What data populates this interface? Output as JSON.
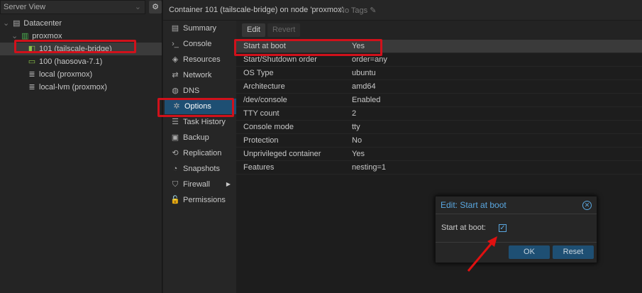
{
  "tree": {
    "view": "Server View",
    "items": [
      {
        "label": "Datacenter",
        "icon": "server-rack-icon"
      },
      {
        "label": "proxmox",
        "icon": "node-icon"
      },
      {
        "label": "101 (tailscale-bridge)",
        "icon": "container-icon"
      },
      {
        "label": "100 (haosova-7.1)",
        "icon": "vm-icon"
      },
      {
        "label": "local (proxmox)",
        "icon": "storage-icon"
      },
      {
        "label": "local-lvm (proxmox)",
        "icon": "storage-icon"
      }
    ]
  },
  "header": {
    "title": "Container 101 (tailscale-bridge) on node 'proxmox'",
    "tags": "No Tags"
  },
  "nav": [
    "Summary",
    "Console",
    "Resources",
    "Network",
    "DNS",
    "Options",
    "Task History",
    "Backup",
    "Replication",
    "Snapshots",
    "Firewall",
    "Permissions"
  ],
  "nav_icons": [
    "▤",
    "›_",
    "◈",
    "⇄",
    "◍",
    "✲",
    "☰",
    "▣",
    "⟲",
    "◔",
    "⛉",
    "🔓"
  ],
  "toolbar": {
    "edit": "Edit",
    "revert": "Revert"
  },
  "options": [
    {
      "k": "Start at boot",
      "v": "Yes"
    },
    {
      "k": "Start/Shutdown order",
      "v": "order=any"
    },
    {
      "k": "OS Type",
      "v": "ubuntu"
    },
    {
      "k": "Architecture",
      "v": "amd64"
    },
    {
      "k": "/dev/console",
      "v": "Enabled"
    },
    {
      "k": "TTY count",
      "v": "2"
    },
    {
      "k": "Console mode",
      "v": "tty"
    },
    {
      "k": "Protection",
      "v": "No"
    },
    {
      "k": "Unprivileged container",
      "v": "Yes"
    },
    {
      "k": "Features",
      "v": "nesting=1"
    }
  ],
  "dialog": {
    "title": "Edit: Start at boot",
    "field": "Start at boot:",
    "checked": true,
    "ok": "OK",
    "reset": "Reset"
  }
}
